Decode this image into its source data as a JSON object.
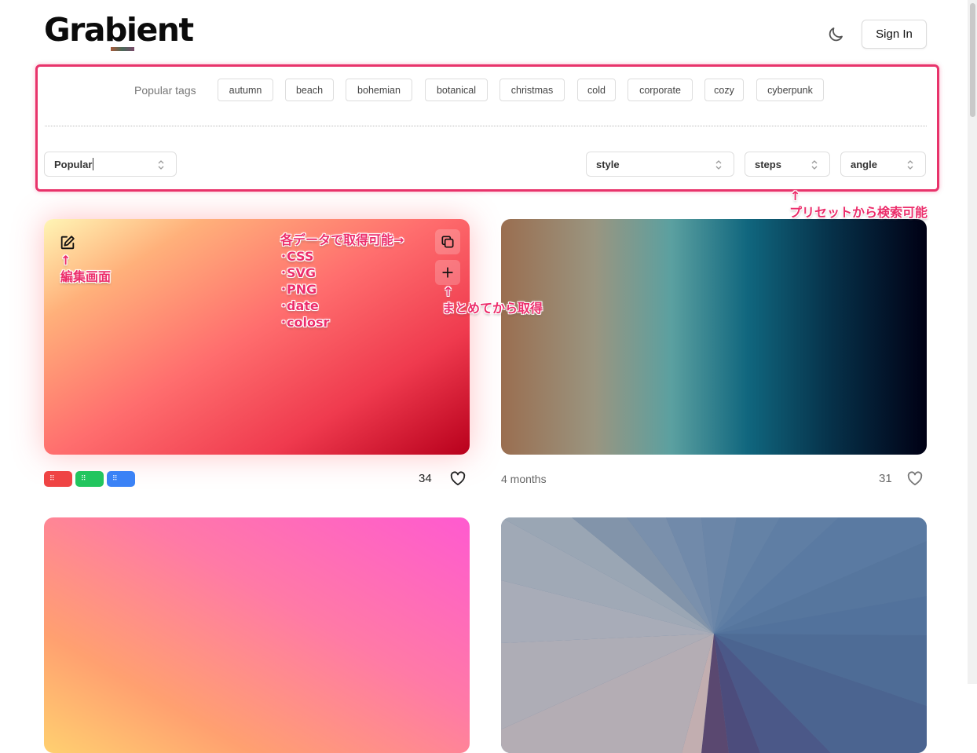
{
  "header": {
    "logo": "Grabient",
    "sign_in": "Sign In"
  },
  "filters": {
    "tags_label": "Popular tags",
    "tags": [
      "autumn",
      "beach",
      "bohemian",
      "botanical",
      "christmas",
      "cold",
      "corporate",
      "cozy",
      "cyberpunk"
    ],
    "sort": "Popular",
    "style": "style",
    "steps": "steps",
    "angle": "angle"
  },
  "annotations": {
    "presets": "↑\nプリセットから検索可能",
    "editor": "↑\n編集画面",
    "export": "各データで取得可能→\n･CSS\n･SVG\n･PNG\n･date\n･colosr",
    "collect": "↑\nまとめてから取得"
  },
  "cards": [
    {
      "likes": "34",
      "meta": "",
      "colors": [
        "#ef4444",
        "#22c55e",
        "#3b82f6"
      ]
    },
    {
      "likes": "31",
      "meta": "4 months"
    }
  ],
  "accent": "#ec2d6b"
}
